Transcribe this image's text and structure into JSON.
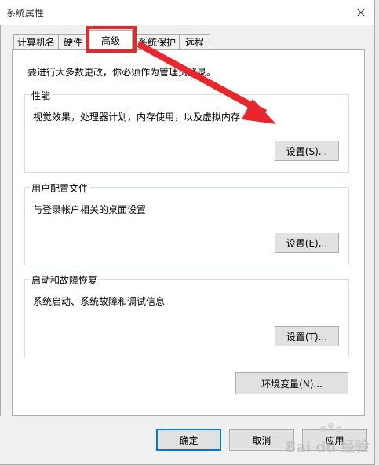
{
  "window": {
    "title": "系统属性"
  },
  "tabs": [
    {
      "label": "计算机名"
    },
    {
      "label": "硬件"
    },
    {
      "label": "高级"
    },
    {
      "label": "系统保护"
    },
    {
      "label": "远程"
    }
  ],
  "active_tab": "高级",
  "main": {
    "admin_note": "要进行大多数更改，你必须作为管理员登录。",
    "performance": {
      "title": "性能",
      "description": "视觉效果，处理器计划，内存使用，以及虚拟内存",
      "settings_button": "设置(S)..."
    },
    "user_profiles": {
      "title": "用户配置文件",
      "description": "与登录帐户相关的桌面设置",
      "settings_button": "设置(E)..."
    },
    "startup_recovery": {
      "title": "启动和故障恢复",
      "description": "系统启动、系统故障和调试信息",
      "settings_button": "设置(T)..."
    },
    "env_vars_button": "环境变量(N)..."
  },
  "footer": {
    "ok": "确定",
    "cancel": "取消",
    "apply": "应用"
  },
  "watermark": {
    "text": "Bai du 经验"
  },
  "colors": {
    "annotation_red": "#e8272c",
    "default_button_border": "#0078d7"
  },
  "icons": {
    "close": "close-icon"
  }
}
